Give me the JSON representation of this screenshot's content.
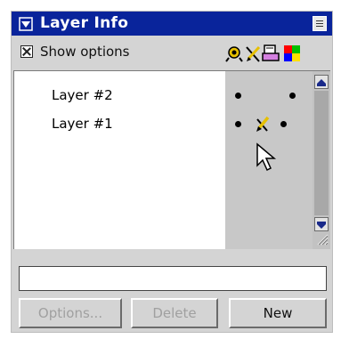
{
  "panel": {
    "title": "Layer Info",
    "show_options_label": "Show options",
    "show_options_checked": true
  },
  "header_icons": [
    "eye-icon",
    "pencil-icon",
    "print-icon",
    "color-swatch-icon"
  ],
  "layers": [
    {
      "name": "Layer #2",
      "visible": true,
      "editable": false,
      "printable": true
    },
    {
      "name": "Layer #1",
      "visible": true,
      "editable": true,
      "printable": true
    }
  ],
  "input": {
    "value": "",
    "placeholder": ""
  },
  "buttons": {
    "options": "Options...",
    "delete": "Delete",
    "new": "New"
  },
  "colors": {
    "titlebar": "#09249b",
    "panel_bg": "#d4d4d4",
    "icon_col_bg": "#c8c8c8"
  }
}
